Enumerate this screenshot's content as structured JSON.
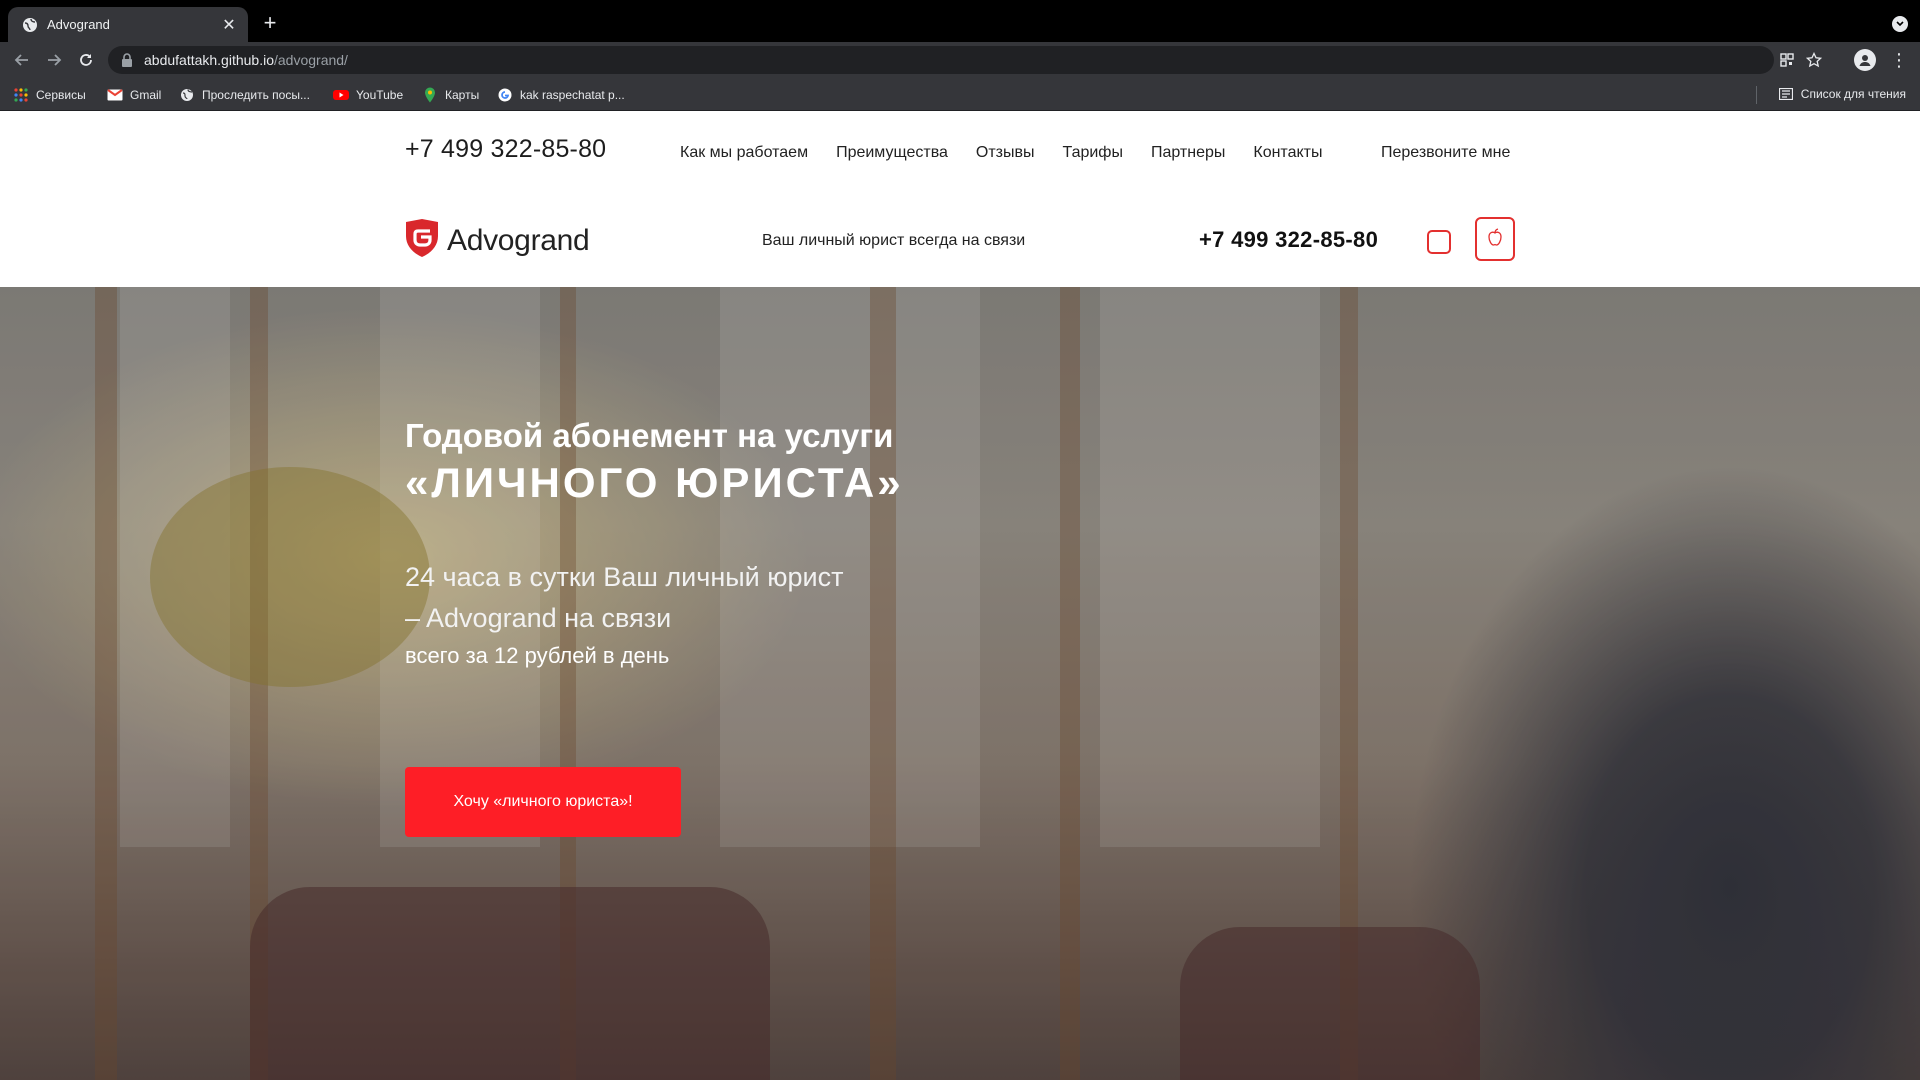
{
  "browser": {
    "tab_title": "Advogrand",
    "tab_close": "✕",
    "new_tab": "+",
    "url_host": "abdufattakh.github.io",
    "url_path": "/advogrand/",
    "menu": "⋮"
  },
  "bookmarks": {
    "items": [
      {
        "label": "Сервисы",
        "icon": "apps-grid-icon"
      },
      {
        "label": "Gmail",
        "icon": "gmail-icon"
      },
      {
        "label": "Проследить посы...",
        "icon": "globe-icon"
      },
      {
        "label": "YouTube",
        "icon": "youtube-icon"
      },
      {
        "label": "Карты",
        "icon": "maps-pin-icon"
      },
      {
        "label": "kak raspechatat p...",
        "icon": "google-icon"
      }
    ],
    "reading_list": "Список для чтения"
  },
  "topbar": {
    "phone": "+7 499 322-85-80",
    "nav": [
      "Как мы работаем",
      "Преимущества",
      "Отзывы",
      "Тарифы",
      "Партнеры",
      "Контакты"
    ],
    "callback": "Перезвоните мне"
  },
  "header": {
    "logo_text": "Advogrand",
    "tagline": "Ваш личный юрист всегда на связи",
    "phone": "+7 499 322-85-80"
  },
  "hero": {
    "title_line1": "Годовой абонемент на услуги",
    "title_line2": "«ЛИЧНОГО ЮРИСТА»",
    "sub_line1": "24 часа в сутки Ваш личный юрист",
    "sub_line2": "– Advogrand на связи",
    "sub_line3": "всего за 12 рублей в день",
    "cta": "Хочу «личного юриста»!"
  },
  "colors": {
    "accent_red": "#fe1e26",
    "icon_border_red": "#e3302f",
    "chrome_dark": "#35363a"
  }
}
